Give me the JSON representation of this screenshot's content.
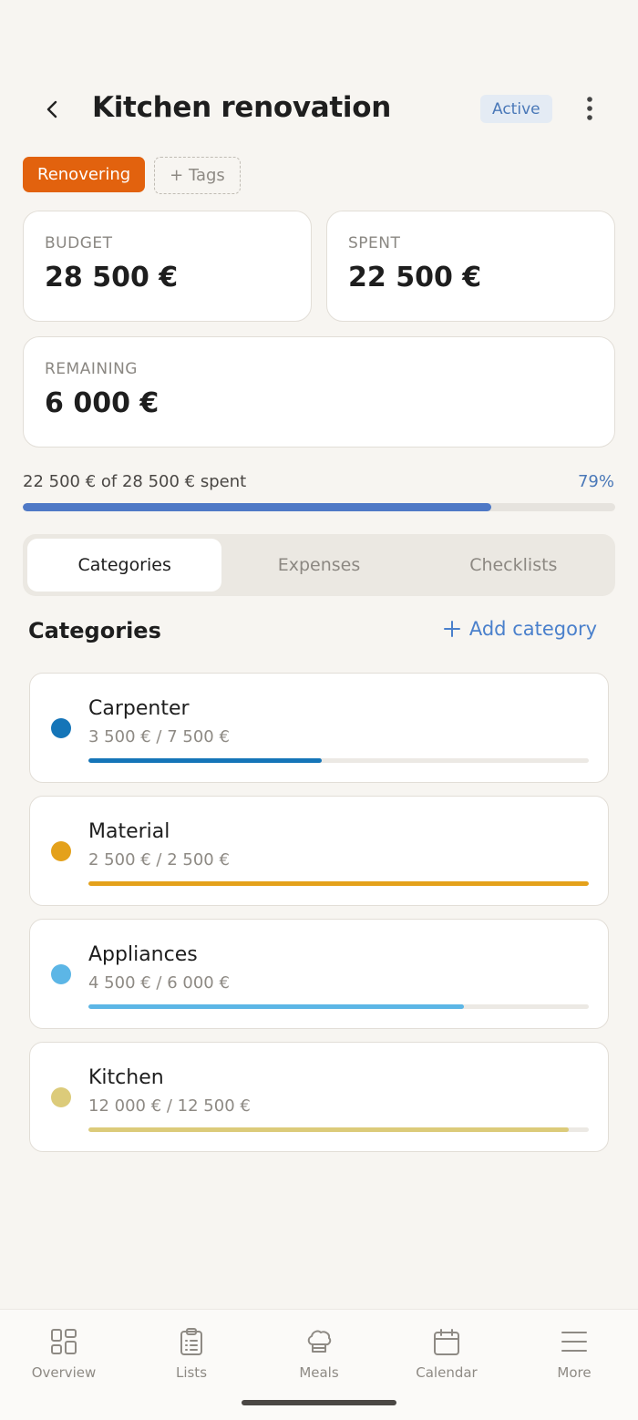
{
  "header": {
    "title": "Kitchen renovation",
    "status": "Active"
  },
  "tags": {
    "items": [
      "Renovering"
    ],
    "add_label": "+ Tags",
    "colors": {
      "Renovering": "#e2620e"
    }
  },
  "stats": {
    "budget_label": "BUDGET",
    "budget_value": "28 500 €",
    "spent_label": "SPENT",
    "spent_value": "22 500 €",
    "remaining_label": "REMAINING",
    "remaining_value": "6 000 €"
  },
  "progress": {
    "text": "22 500 € of 28 500 € spent",
    "percent_label": "79%",
    "fraction": 0.79
  },
  "tabs": [
    {
      "label": "Categories",
      "active": true
    },
    {
      "label": "Expenses",
      "active": false
    },
    {
      "label": "Checklists",
      "active": false
    }
  ],
  "categories_section": {
    "title": "Categories",
    "add_label": "Add category"
  },
  "categories": [
    {
      "name": "Carpenter",
      "amount": "3 500 € / 7 500 €",
      "fraction": 0.4667,
      "color": "#1575b8"
    },
    {
      "name": "Material",
      "amount": "2 500 € / 2 500 €",
      "fraction": 1.0,
      "color": "#e4a11b"
    },
    {
      "name": "Appliances",
      "amount": "4 500 € / 6 000 €",
      "fraction": 0.75,
      "color": "#5cb6e6"
    },
    {
      "name": "Kitchen",
      "amount": "12 000 € / 12 500 €",
      "fraction": 0.96,
      "color": "#dccb7a"
    }
  ],
  "nav": [
    {
      "label": "Overview",
      "icon": "overview-icon"
    },
    {
      "label": "Lists",
      "icon": "clipboard-list-icon"
    },
    {
      "label": "Meals",
      "icon": "chef-hat-icon"
    },
    {
      "label": "Calendar",
      "icon": "calendar-icon"
    },
    {
      "label": "More",
      "icon": "menu-lines-icon"
    }
  ]
}
